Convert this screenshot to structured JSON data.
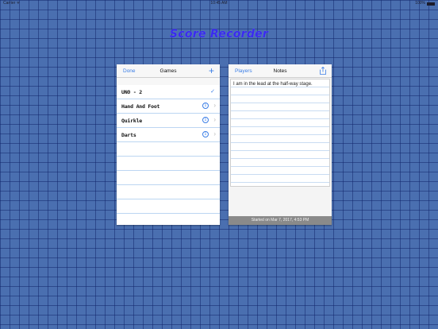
{
  "status_bar": {
    "carrier": "Carrier ᯤ",
    "time": "10:45 AM",
    "battery": "100%"
  },
  "app": {
    "title": "Score Recorder"
  },
  "games_panel": {
    "done_label": "Done",
    "title": "Games",
    "add_label": "+",
    "items": [
      {
        "name": "UNO - 2",
        "selected": true
      },
      {
        "name": "Hand And Foot",
        "selected": false
      },
      {
        "name": "Quirkle",
        "selected": false
      },
      {
        "name": "Darts",
        "selected": false
      }
    ]
  },
  "notes_panel": {
    "players_label": "Players",
    "title": "Notes",
    "share_icon": "share-icon",
    "note_text": "I am in the lead at the half-way stage.",
    "footer": "Started on Mar 7, 2017, 4:53 PM"
  },
  "colors": {
    "background": "#4a6fb0",
    "accent": "#3b7ee6",
    "title": "#3a2bf0"
  }
}
